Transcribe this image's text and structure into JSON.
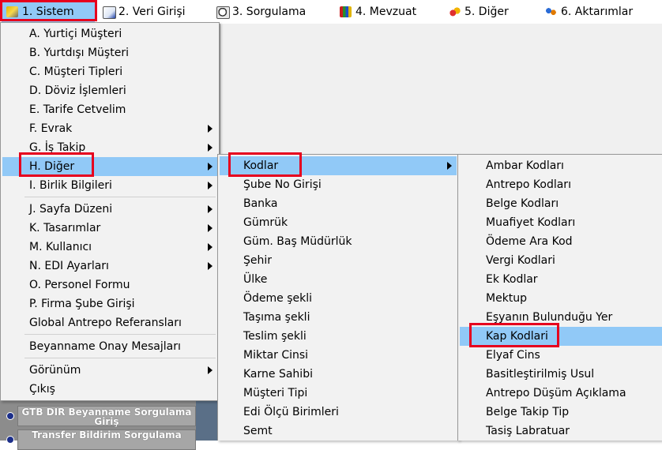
{
  "menubar": {
    "items": [
      {
        "label": "1.  Sistem",
        "icon": "wrench-gear-icon"
      },
      {
        "label": "2.  Veri Girişi",
        "icon": "pen-paper-icon"
      },
      {
        "label": "3.  Sorgulama",
        "icon": "magnifier-document-icon"
      },
      {
        "label": "4.  Mevzuat",
        "icon": "books-icon"
      },
      {
        "label": "5.  Diğer",
        "icon": "shapes-icon"
      },
      {
        "label": "6.  Aktarımlar",
        "icon": "people-transfer-icon"
      }
    ]
  },
  "menu1": {
    "items": [
      {
        "label": "A.  Yurtiçi Müşteri"
      },
      {
        "label": "B.  Yurtdışı Müşteri"
      },
      {
        "label": "C.  Müşteri Tipleri"
      },
      {
        "label": "D.   Döviz İşlemleri"
      },
      {
        "label": "E.  Tarife Cetvelim"
      },
      {
        "label": "F.  Evrak"
      },
      {
        "label": "G.  İş Takip"
      },
      {
        "label": "H.  Diğer"
      },
      {
        "label": "I.  Birlik Bilgileri"
      },
      {
        "label": "J.  Sayfa Düzeni"
      },
      {
        "label": "K.  Tasarımlar"
      },
      {
        "label": "M.  Kullanıcı"
      },
      {
        "label": "N.  EDI Ayarları"
      },
      {
        "label": "O.  Personel Formu"
      },
      {
        "label": "P.  Firma Şube Girişi"
      },
      {
        "label": "Global Antrepo Referansları"
      },
      {
        "label": "Beyanname Onay Mesajları"
      },
      {
        "label": "Görünüm"
      },
      {
        "label": "Çıkış"
      }
    ]
  },
  "menu2": {
    "items": [
      {
        "label": "Kodlar"
      },
      {
        "label": "Şube No Girişi"
      },
      {
        "label": "Banka"
      },
      {
        "label": "Gümrük"
      },
      {
        "label": "Güm. Baş Müdürlük"
      },
      {
        "label": "Şehir"
      },
      {
        "label": "Ülke"
      },
      {
        "label": "Ödeme şekli"
      },
      {
        "label": "Taşıma şekli"
      },
      {
        "label": "Teslim şekli"
      },
      {
        "label": "Miktar Cinsi"
      },
      {
        "label": "Karne Sahibi"
      },
      {
        "label": "Müşteri  Tipi"
      },
      {
        "label": "Edi Ölçü Birimleri"
      },
      {
        "label": "Semt"
      }
    ]
  },
  "menu3": {
    "items": [
      {
        "label": "Ambar Kodları"
      },
      {
        "label": "Antrepo Kodları"
      },
      {
        "label": "Belge Kodları"
      },
      {
        "label": "Muafiyet Kodları"
      },
      {
        "label": "Ödeme Ara Kod"
      },
      {
        "label": "Vergi Kodlari"
      },
      {
        "label": "Ek Kodlar"
      },
      {
        "label": "Mektup"
      },
      {
        "label": "Eşyanın Bulunduğu Yer"
      },
      {
        "label": "Kap Kodlari"
      },
      {
        "label": "Elyaf Cins"
      },
      {
        "label": "Basitleştirilmiş Usul"
      },
      {
        "label": "Antrepo Düşüm Açıklama"
      },
      {
        "label": "Belge Takip Tip"
      },
      {
        "label": "Tasiş Labratuar"
      }
    ]
  },
  "background": {
    "btn1": "GTB DIR Beyanname Sorgulama Giriş",
    "btn2": "Transfer Bildirim Sorgulama"
  },
  "colors": {
    "highlight": "#91c9f7",
    "menu_bg": "#f2f2f2",
    "annotation_red": "#e6001e"
  }
}
